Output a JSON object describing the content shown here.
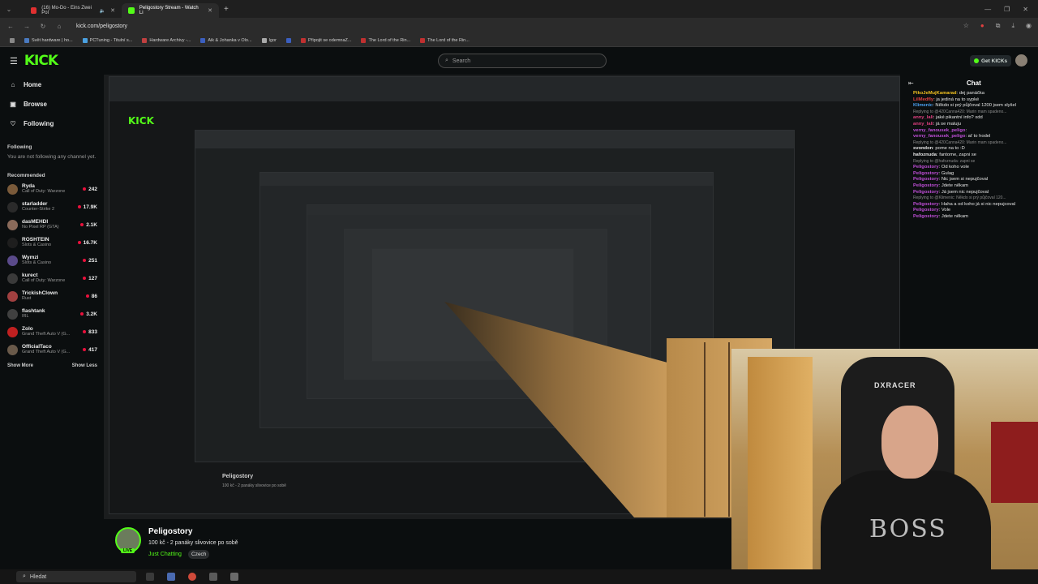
{
  "browser": {
    "tabs": [
      {
        "label": "(16) Mo-Do - Eins Zwei Pol",
        "active": false
      },
      {
        "label": "Peligostory Stream - Watch Li",
        "active": true
      }
    ],
    "url": "kick.com/peligostory",
    "bookmarks": [
      "Svět hardware | ho...",
      "PCTuning - Titulní s...",
      "Hardware Archivy -...",
      "Aik & Johanka v Olo...",
      "Igor",
      "",
      "Připojit se odemnaZ...",
      "The Lord of the Rin...",
      "The Lord of the Rin..."
    ]
  },
  "header": {
    "logo": "KICK",
    "search_placeholder": "Search",
    "get_kicks": "Get KICKs"
  },
  "sidebar": {
    "nav": [
      {
        "label": "Home",
        "icon": "home-icon"
      },
      {
        "label": "Browse",
        "icon": "browse-icon"
      },
      {
        "label": "Following",
        "icon": "heart-icon"
      }
    ],
    "following_heading": "Following",
    "following_note": "You are not following any channel yet.",
    "recommended_heading": "Recommended",
    "recommended": [
      {
        "name": "Ryda",
        "game": "Call of Duty: Warzone",
        "viewers": "242",
        "color": "#7a5a3a"
      },
      {
        "name": "starladder",
        "game": "Counter-Strike 2",
        "viewers": "17.9K",
        "color": "#2a2a2a"
      },
      {
        "name": "dasMEHDI",
        "game": "No Pixel RP (GTA)",
        "viewers": "2.1K",
        "color": "#8a6a5a"
      },
      {
        "name": "ROSHTEIN",
        "game": "Slots & Casino",
        "viewers": "16.7K",
        "color": "#1e1e1e"
      },
      {
        "name": "Wymzi",
        "game": "Slots & Casino",
        "viewers": "251",
        "color": "#5a4a8a"
      },
      {
        "name": "kurect",
        "game": "Call of Duty: Warzone",
        "viewers": "127",
        "color": "#3a3a3a"
      },
      {
        "name": "TrickishClown",
        "game": "Rust",
        "viewers": "86",
        "color": "#a04040"
      },
      {
        "name": "flashtank",
        "game": "IRL",
        "viewers": "3.2K",
        "color": "#404040"
      },
      {
        "name": "Zolo",
        "game": "Grand Theft Auto V (G...",
        "viewers": "833",
        "color": "#c02020"
      },
      {
        "name": "OfficialTaco",
        "game": "Grand Theft Auto V (G...",
        "viewers": "417",
        "color": "#6a5a4a"
      }
    ],
    "show_more": "Show More",
    "show_less": "Show Less"
  },
  "stream": {
    "channel": "Peligostory",
    "title": "100 kč - 2 panáky slivovice po sobě",
    "category": "Just Chatting",
    "tag": "Czech",
    "live_badge": "LIVE",
    "webcam_shirt_text": "BOSS",
    "webcam_chair_text": "DXRACER"
  },
  "chat": {
    "title": "Chat",
    "messages": [
      {
        "user": "PikoJeMujKamarad",
        "text": "dej panáčka",
        "color": "#f0c020",
        "reply": ""
      },
      {
        "user": "LilMedfly",
        "text": "ja jediná na to sypké",
        "color": "#e04040",
        "reply": ""
      },
      {
        "user": "Klimenic",
        "text": "Někdo si prý půjčoval 1200 jsem slyšel",
        "color": "#4aa0f0",
        "reply": ""
      },
      {
        "user": "",
        "text": "",
        "color": "",
        "reply": "Replying to @420Canna420: Marin mam spadeno..."
      },
      {
        "user": "anny_lali",
        "text": "jaké pikantní info? xdd",
        "color": "#e04080",
        "reply": ""
      },
      {
        "user": "anny_lali",
        "text": "já se maluju",
        "color": "#e04080",
        "reply": ""
      },
      {
        "user": "verny_fanousek_peligo",
        "text": "",
        "color": "#c04fd8",
        "reply": ""
      },
      {
        "user": "verny_fanousek_peligo",
        "text": "ať to hodel",
        "color": "#c04fd8",
        "reply": ""
      },
      {
        "user": "",
        "text": "",
        "color": "",
        "reply": "Replying to @420Canna420: Marin mam spadeno..."
      },
      {
        "user": "svondon",
        "text": "pome na to :D",
        "color": "#e6e6e6",
        "reply": ""
      },
      {
        "user": "hafoznuda",
        "text": "fantome, zapni se",
        "color": "#e6e6e6",
        "reply": ""
      },
      {
        "user": "",
        "text": "",
        "color": "",
        "reply": "Replying to @hafoznuda: zapni se"
      },
      {
        "user": "Peligostory",
        "text": "Od koho vole",
        "color": "#c04fd8",
        "reply": ""
      },
      {
        "user": "Peligostory",
        "text": "Gulag",
        "color": "#c04fd8",
        "reply": ""
      },
      {
        "user": "Peligostory",
        "text": "Nic jsem si nepujčoval",
        "color": "#c04fd8",
        "reply": ""
      },
      {
        "user": "Peligostory",
        "text": "Jdete někam",
        "color": "#c04fd8",
        "reply": ""
      },
      {
        "user": "Peligostory",
        "text": "Já jsem nic nepujčoval",
        "color": "#c04fd8",
        "reply": ""
      },
      {
        "user": "",
        "text": "",
        "color": "",
        "reply": "Replying to @Klimenic: Někdo si prý půjčoval 120..."
      },
      {
        "user": "Peligostory",
        "text": "Haha a od koho já si nic nepujcoval",
        "color": "#c04fd8",
        "reply": ""
      },
      {
        "user": "Peligostory",
        "text": "Vole",
        "color": "#c04fd8",
        "reply": ""
      },
      {
        "user": "Peligostory",
        "text": "Jdete někam",
        "color": "#c04fd8",
        "reply": ""
      }
    ]
  },
  "taskbar": {
    "search_label": "Hledat"
  },
  "colors": {
    "brand": "#53fc18",
    "background": "#0b0e0f",
    "live_dot": "#e9113c"
  }
}
